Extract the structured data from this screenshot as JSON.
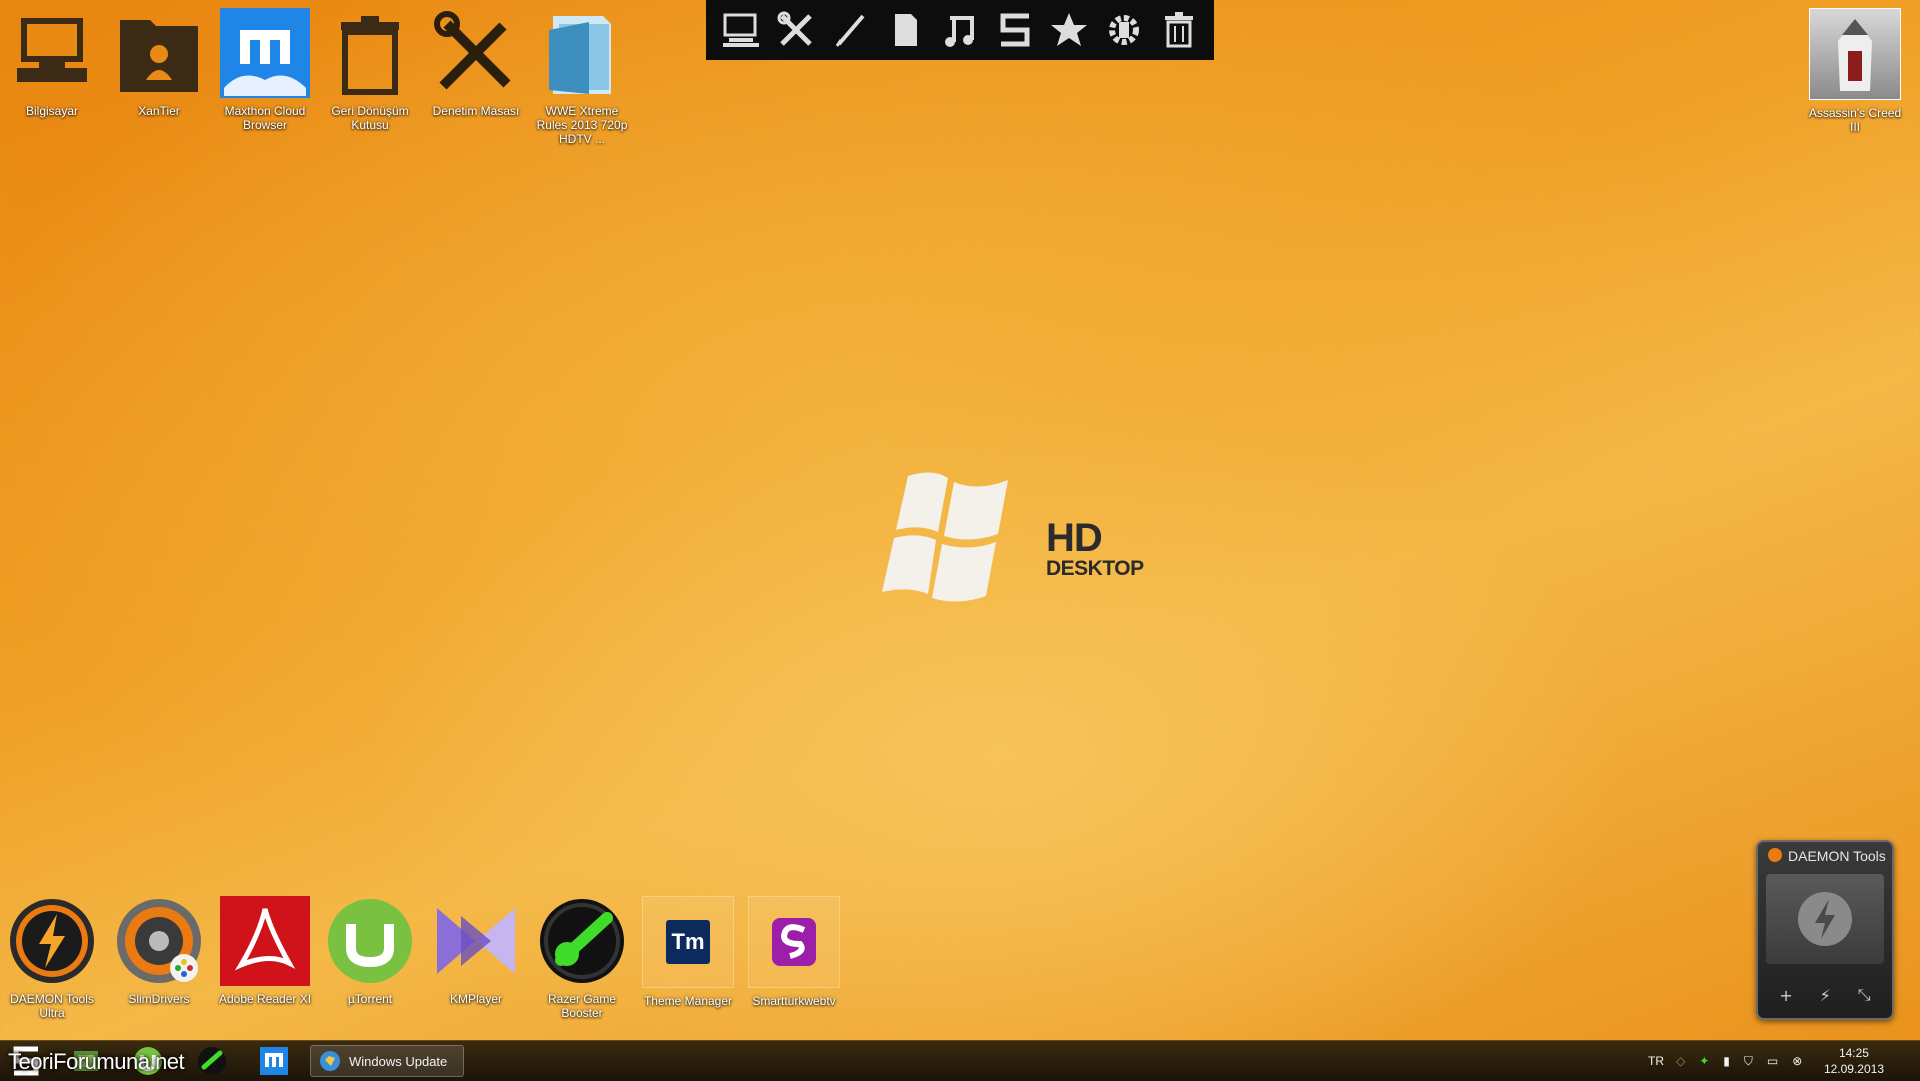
{
  "desktop_top_icons": [
    {
      "name": "computer-icon",
      "label": "Bilgisayar"
    },
    {
      "name": "user-folder-icon",
      "label": "XanTier"
    },
    {
      "name": "maxthon-icon",
      "label": "Maxthon Cloud Browser"
    },
    {
      "name": "recycle-bin-icon",
      "label": "Geri Dönüşüm Kutusu"
    },
    {
      "name": "control-panel-icon",
      "label": "Denetim Masası"
    },
    {
      "name": "folder-icon",
      "label": "WWE Xtreme Rules 2013 720p HDTV ..."
    }
  ],
  "desktop_right_icon": {
    "name": "game-shortcut-icon",
    "label": "Assassin's Creed III"
  },
  "desktop_bottom_icons": [
    {
      "name": "daemon-tools-icon",
      "label": "DAEMON Tools Ultra"
    },
    {
      "name": "slimdrivers-icon",
      "label": "SlimDrivers"
    },
    {
      "name": "adobe-reader-icon",
      "label": "Adobe Reader XI"
    },
    {
      "name": "utorrent-icon",
      "label": "µTorrent"
    },
    {
      "name": "kmplayer-icon",
      "label": "KMPlayer"
    },
    {
      "name": "razer-game-booster-icon",
      "label": "Razer Game Booster"
    },
    {
      "name": "theme-manager-icon",
      "label": "Theme Manager",
      "badge": "Tm"
    },
    {
      "name": "smartturkwebtv-icon",
      "label": "Smarttürkwebtv"
    }
  ],
  "toolbar": {
    "items": [
      "computer-icon",
      "tools-icon",
      "pen-icon",
      "document-icon",
      "music-icon",
      "s-icon",
      "star-icon",
      "settings-icon",
      "trash-icon"
    ]
  },
  "wallpaper": {
    "line1": "HD",
    "line2": "DESKTOP"
  },
  "daemon_widget": {
    "title": "DAEMON Tools",
    "buttons": [
      "+",
      "⚡",
      "⤡"
    ]
  },
  "taskbar": {
    "window_button": "Windows Update",
    "language": "TR",
    "time": "14:25",
    "date": "12.09.2013",
    "watermark": "TeoriForumuna.net"
  },
  "colors": {
    "accent": "#f0a026",
    "taskbar": "#2a1e0c"
  }
}
